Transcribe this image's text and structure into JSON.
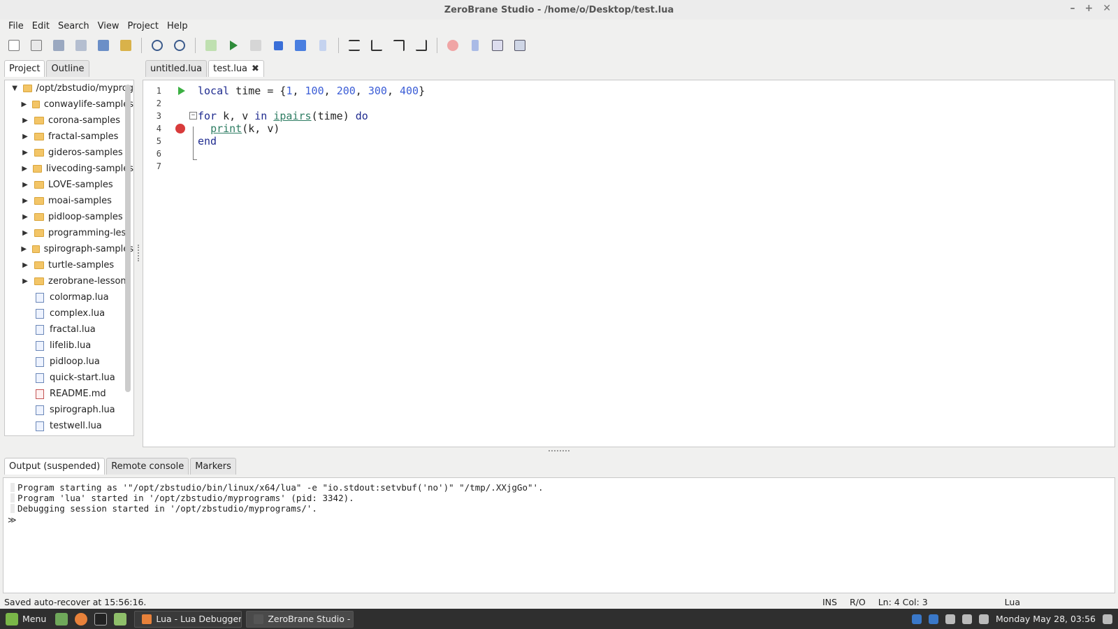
{
  "window": {
    "title": "ZeroBrane Studio - /home/o/Desktop/test.lua",
    "controls": [
      "–",
      "+",
      "✕"
    ]
  },
  "menu": [
    "File",
    "Edit",
    "Search",
    "View",
    "Project",
    "Help"
  ],
  "left_panel": {
    "tabs": [
      "Project",
      "Outline"
    ],
    "tree_root": "/opt/zbstudio/myprog",
    "folders": [
      "conwaylife-samples",
      "corona-samples",
      "fractal-samples",
      "gideros-samples",
      "livecoding-samples",
      "LOVE-samples",
      "moai-samples",
      "pidloop-samples",
      "programming-less",
      "spirograph-samples",
      "turtle-samples",
      "zerobrane-lessons"
    ],
    "files": [
      "colormap.lua",
      "complex.lua",
      "fractal.lua",
      "lifelib.lua",
      "pidloop.lua",
      "quick-start.lua",
      "README.md",
      "spirograph.lua",
      "testwell.lua"
    ]
  },
  "editor": {
    "tabs": [
      "untitled.lua",
      "test.lua"
    ],
    "close_glyph": "✖",
    "line_numbers": [
      "1",
      "2",
      "3",
      "4",
      "5",
      "6",
      "7"
    ],
    "code": {
      "l1_a": "local",
      "l1_b": " time = {",
      "l1_n1": "1",
      "l1_c": ", ",
      "l1_n2": "100",
      "l1_d": ", ",
      "l1_n3": "200",
      "l1_e": ", ",
      "l1_n4": "300",
      "l1_f": ", ",
      "l1_n5": "400",
      "l1_g": "}",
      "l3_for": "for",
      "l3_mid": " k, v ",
      "l3_in": "in",
      "l3_sp": " ",
      "l3_fn": "ipairs",
      "l3_args": "(time) ",
      "l3_do": "do",
      "l4_indent": "  ",
      "l4_fn": "print",
      "l4_args": "(k, v)",
      "l5_end": "end"
    },
    "fold_glyph": "−"
  },
  "bottom_panel": {
    "tabs": [
      "Output (suspended)",
      "Remote console",
      "Markers"
    ],
    "lines": [
      "Program starting as '\"/opt/zbstudio/bin/linux/x64/lua\" -e \"io.stdout:setvbuf('no')\" \"/tmp/.XXjgGo\"'.",
      "Program 'lua' started in '/opt/zbstudio/myprograms' (pid: 3342).",
      "Debugging session started in '/opt/zbstudio/myprograms/'."
    ],
    "prompt": "≫"
  },
  "status": {
    "message": "Saved auto-recover at 15:56:16.",
    "mode": "INS",
    "access": "R/O",
    "position": "Ln: 4 Col: 3",
    "language": "Lua"
  },
  "taskbar": {
    "menu_label": "Menu",
    "tasks": [
      "Lua - Lua Debugger ...",
      "ZeroBrane Studio - /..."
    ],
    "clock": "Monday May 28, 03:56"
  },
  "toolbar_icons": [
    "new-file-icon",
    "open-file-icon",
    "save-icon",
    "save-all-icon",
    "project-dir-icon",
    "project-dir-choose-icon",
    "find-icon",
    "find-in-files-icon",
    "run-as-scratchpad-icon",
    "run-icon",
    "run-to-cursor-icon",
    "stop-icon",
    "continue-icon",
    "break-icon",
    "step-into-icon",
    "step-over-icon",
    "step-out-icon",
    "run-to-icon",
    "toggle-breakpoint-icon",
    "bookmark-icon",
    "stack-window-icon",
    "watch-window-icon"
  ],
  "colors": {
    "keyword": "#1f2b8f",
    "number": "#3b5dd6",
    "builtin": "#2e7d63",
    "breakpoint": "#d83b3b",
    "exec_marker": "#3cb043"
  }
}
